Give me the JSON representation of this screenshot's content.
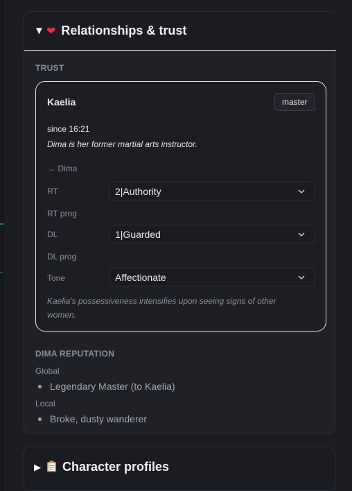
{
  "relationships_panel": {
    "title": "Relationships & trust",
    "expand_icon": "triangle-down",
    "emoji": "heart-icon"
  },
  "trust": {
    "section_label": "TRUST",
    "card": {
      "name": "Kaelia",
      "badge": "master",
      "since": "since 16:21",
      "description": "Dima is her former martial arts instructor.",
      "target": "→ Dima",
      "rows": {
        "rt_label": "RT",
        "rt_value": "2|Authority",
        "rt_prog_label": "RT prog",
        "dl_label": "DL",
        "dl_value": "1|Guarded",
        "dl_prog_label": "DL prog",
        "tone_label": "Tone",
        "tone_value": "Affectionate"
      },
      "note": "Kaelia's possessiveness intensifies upon seeing signs of other women."
    }
  },
  "reputation": {
    "section_label": "DIMA REPUTATION",
    "global_label": "Global",
    "global_items": [
      "Legendary Master (to Kaelia)"
    ],
    "local_label": "Local",
    "local_items": [
      "Broke, dusty wanderer"
    ]
  },
  "profiles_panel": {
    "title": "Character profiles",
    "expand_icon": "triangle-right",
    "emoji": "clipboard-icon"
  },
  "colors": {
    "background": "#1b1d22",
    "card_border": "#e3e5ea",
    "muted_text": "#8b9099",
    "heart": "#e0314b"
  }
}
